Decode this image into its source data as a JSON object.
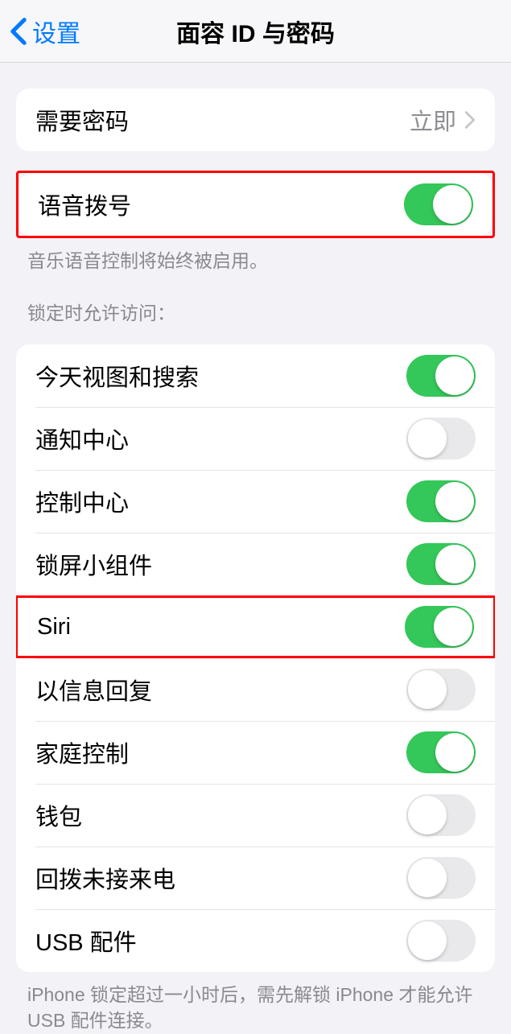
{
  "nav": {
    "back": "设置",
    "title": "面容 ID 与密码"
  },
  "section_passcode": {
    "require_label": "需要密码",
    "require_value": "立即"
  },
  "section_voice": {
    "voice_dial_label": "语音拨号",
    "voice_dial_on": true,
    "footer": "音乐语音控制将始终被启用。"
  },
  "section_locked": {
    "header": "锁定时允许访问：",
    "items": [
      {
        "label": "今天视图和搜索",
        "on": true
      },
      {
        "label": "通知中心",
        "on": false
      },
      {
        "label": "控制中心",
        "on": true
      },
      {
        "label": "锁屏小组件",
        "on": true
      },
      {
        "label": "Siri",
        "on": true
      },
      {
        "label": "以信息回复",
        "on": false
      },
      {
        "label": "家庭控制",
        "on": true
      },
      {
        "label": "钱包",
        "on": false
      },
      {
        "label": "回拨未接来电",
        "on": false
      },
      {
        "label": "USB 配件",
        "on": false
      }
    ],
    "footer": "iPhone 锁定超过一小时后，需先解锁 iPhone 才能允许 USB 配件连接。"
  }
}
